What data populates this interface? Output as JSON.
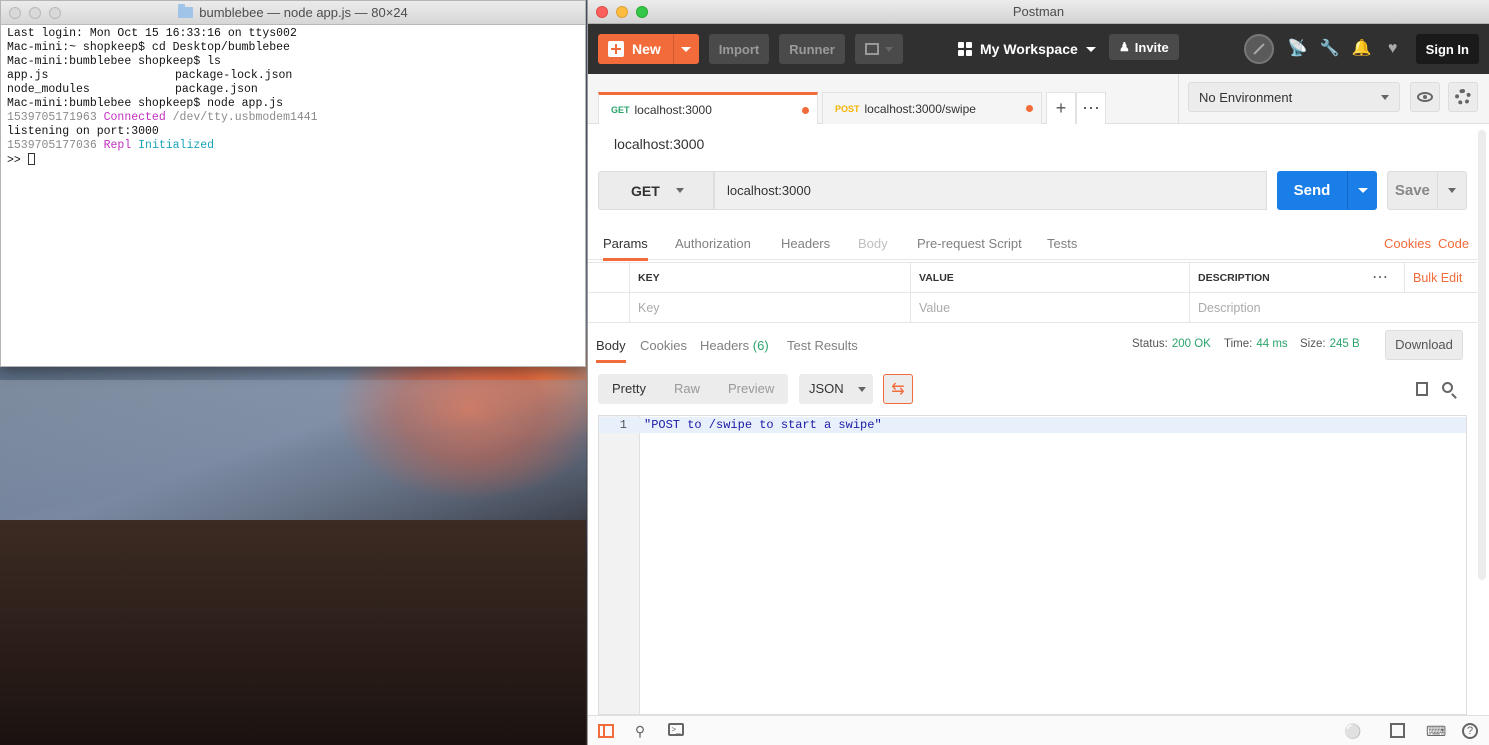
{
  "terminal": {
    "title": "bumblebee — node app.js — 80×24",
    "lines": {
      "l1": "Last login: Mon Oct 15 16:33:16 on ttys002",
      "l2": "Mac-mini:~ shopkeep$ cd Desktop/bumblebee",
      "l3": "Mac-mini:bumblebee shopkeep$ ls",
      "l4a": "app.js",
      "l4b": "package-lock.json",
      "l5a": "node_modules",
      "l5b": "package.json",
      "l6": "Mac-mini:bumblebee shopkeep$ node app.js",
      "l7ts": "1539705171963",
      "l7kw": "Connected",
      "l7rest": "/dev/tty.usbmodem1441",
      "l8": "listening on port:3000",
      "l9ts": "1539705177036",
      "l9kw": "Repl",
      "l9rest": "Initialized",
      "prompt": ">>"
    }
  },
  "postman": {
    "title": "Postman",
    "header": {
      "new_label": "New",
      "import_label": "Import",
      "runner_label": "Runner",
      "workspace_label": "My Workspace",
      "invite_label": "Invite",
      "signin_label": "Sign In"
    },
    "tabs": [
      {
        "method": "GET",
        "label": "localhost:3000"
      },
      {
        "method": "POST",
        "label": "localhost:3000/swipe"
      }
    ],
    "environment": "No Environment",
    "request_name": "localhost:3000",
    "request": {
      "method": "GET",
      "url": "localhost:3000",
      "send_label": "Send",
      "save_label": "Save"
    },
    "request_tabs": {
      "params": "Params",
      "authorization": "Authorization",
      "headers": "Headers",
      "body": "Body",
      "prerequest": "Pre-request Script",
      "tests": "Tests",
      "cookies": "Cookies",
      "code": "Code"
    },
    "params_table": {
      "key_header": "KEY",
      "value_header": "VALUE",
      "description_header": "DESCRIPTION",
      "bulk_edit": "Bulk Edit",
      "key_placeholder": "Key",
      "value_placeholder": "Value",
      "description_placeholder": "Description"
    },
    "response_tabs": {
      "body": "Body",
      "cookies": "Cookies",
      "headers": "Headers",
      "headers_count": "(6)",
      "test_results": "Test Results"
    },
    "response_status": {
      "status_label": "Status:",
      "status_value": "200 OK",
      "time_label": "Time:",
      "time_value": "44 ms",
      "size_label": "Size:",
      "size_value": "245 B",
      "download_label": "Download"
    },
    "format": {
      "pretty": "Pretty",
      "raw": "Raw",
      "preview": "Preview",
      "language": "JSON"
    },
    "response_body": {
      "line_number": "1",
      "content": "\"POST to /swipe to start a swipe\""
    },
    "colors": {
      "accent": "#f26b3a",
      "send": "#1a7ee8",
      "success": "#2aa36b"
    }
  }
}
